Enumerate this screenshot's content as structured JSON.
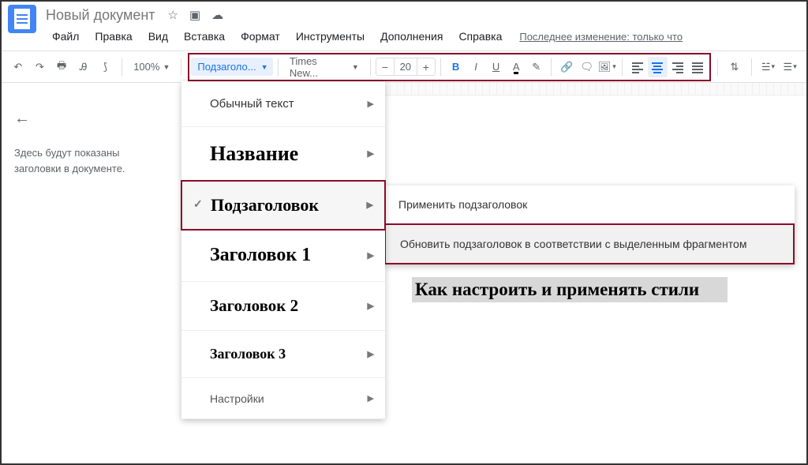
{
  "header": {
    "doc_title": "Новый документ",
    "icons": {
      "star": "☆",
      "move": "▣",
      "cloud": "☁"
    },
    "menu": [
      "Файл",
      "Правка",
      "Вид",
      "Вставка",
      "Формат",
      "Инструменты",
      "Дополнения",
      "Справка"
    ],
    "last_change": "Последнее изменение: только что"
  },
  "toolbar": {
    "zoom": "100%",
    "style_label": "Подзаголо...",
    "font_label": "Times New...",
    "font_size": "20"
  },
  "outline": {
    "placeholder": "Здесь будут показаны заголовки в документе."
  },
  "styles_menu": {
    "items": [
      {
        "label": "Обычный текст",
        "cls": "sm-normal"
      },
      {
        "label": "Название",
        "cls": "sm-title"
      },
      {
        "label": "Подзаголовок",
        "cls": "sm-sub",
        "checked": true,
        "highlighted": true
      },
      {
        "label": "Заголовок 1",
        "cls": "sm-h1"
      },
      {
        "label": "Заголовок 2",
        "cls": "sm-h2"
      },
      {
        "label": "Заголовок 3",
        "cls": "sm-h3"
      },
      {
        "label": "Настройки",
        "cls": "sm-opt"
      }
    ]
  },
  "submenu": {
    "apply": "Применить подзаголовок",
    "update": "Обновить подзаголовок в соответствии с выделенным фрагментом"
  },
  "document": {
    "heading_text": "Как настроить и применять стили"
  }
}
